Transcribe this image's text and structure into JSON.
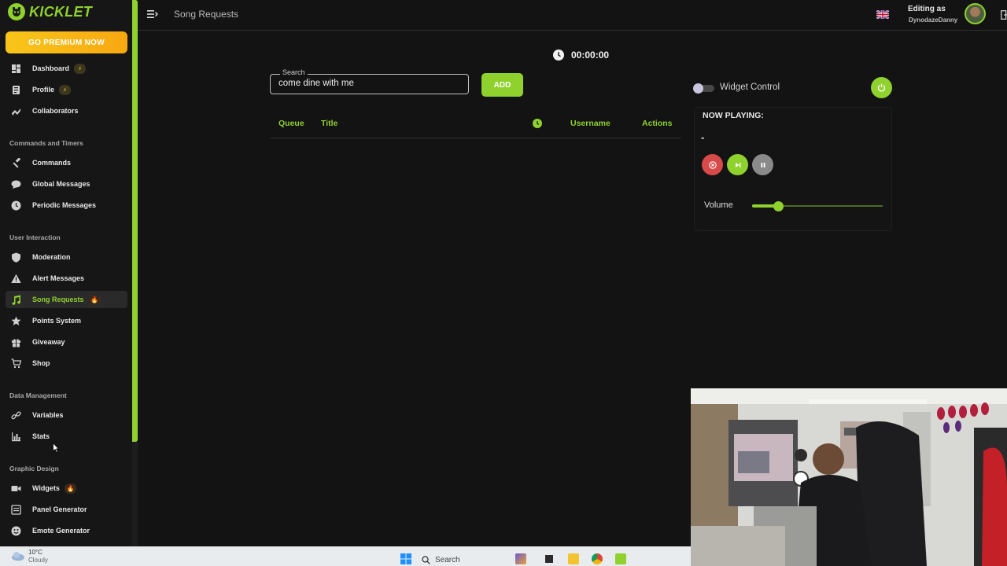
{
  "brand": {
    "name": "KICKLET"
  },
  "premium": {
    "label": "GO PREMIUM NOW"
  },
  "sidebar": {
    "top": [
      {
        "label": "Dashboard",
        "icon": "dashboard-icon",
        "badge": "bolt"
      },
      {
        "label": "Profile",
        "icon": "profile-icon",
        "badge": "bolt"
      },
      {
        "label": "Collaborators",
        "icon": "collaborators-icon"
      }
    ],
    "sections": [
      {
        "title": "Commands and Timers",
        "items": [
          {
            "label": "Commands",
            "icon": "hammer-icon"
          },
          {
            "label": "Global Messages",
            "icon": "chat-icon"
          },
          {
            "label": "Periodic Messages",
            "icon": "clock-icon"
          }
        ]
      },
      {
        "title": "User Interaction",
        "items": [
          {
            "label": "Moderation",
            "icon": "shield-icon"
          },
          {
            "label": "Alert Messages",
            "icon": "warning-icon"
          },
          {
            "label": "Song Requests",
            "icon": "music-icon",
            "badge": "fire",
            "active": true
          },
          {
            "label": "Points System",
            "icon": "star-icon"
          },
          {
            "label": "Giveaway",
            "icon": "gift-icon"
          },
          {
            "label": "Shop",
            "icon": "cart-icon"
          }
        ]
      },
      {
        "title": "Data Management",
        "items": [
          {
            "label": "Variables",
            "icon": "link-icon"
          },
          {
            "label": "Stats",
            "icon": "bar-chart-icon"
          }
        ]
      },
      {
        "title": "Graphic Design",
        "items": [
          {
            "label": "Widgets",
            "icon": "video-icon",
            "badge": "fire"
          },
          {
            "label": "Panel Generator",
            "icon": "panel-icon"
          },
          {
            "label": "Emote Generator",
            "icon": "emoji-icon"
          }
        ]
      }
    ]
  },
  "topbar": {
    "title": "Song Requests",
    "editing_label": "Editing as",
    "username": "DynodazeDanny"
  },
  "player": {
    "timer": "00:00:00",
    "search_label": "Search",
    "search_value": "come dine with me",
    "add_label": "ADD",
    "table_headers": {
      "queue": "Queue",
      "title": "Title",
      "username": "Username",
      "actions": "Actions"
    },
    "widget_control_label": "Widget Control",
    "now_playing_label": "NOW PLAYING:",
    "now_playing_track": "-",
    "volume_label": "Volume",
    "volume_level": 0.2
  },
  "taskbar": {
    "weather_temp": "10°C",
    "weather_desc": "Cloudy",
    "search_label": "Search"
  },
  "colors": {
    "accent": "#8fd12d",
    "premium": "#f9c51a",
    "stop": "#d84a4a"
  }
}
